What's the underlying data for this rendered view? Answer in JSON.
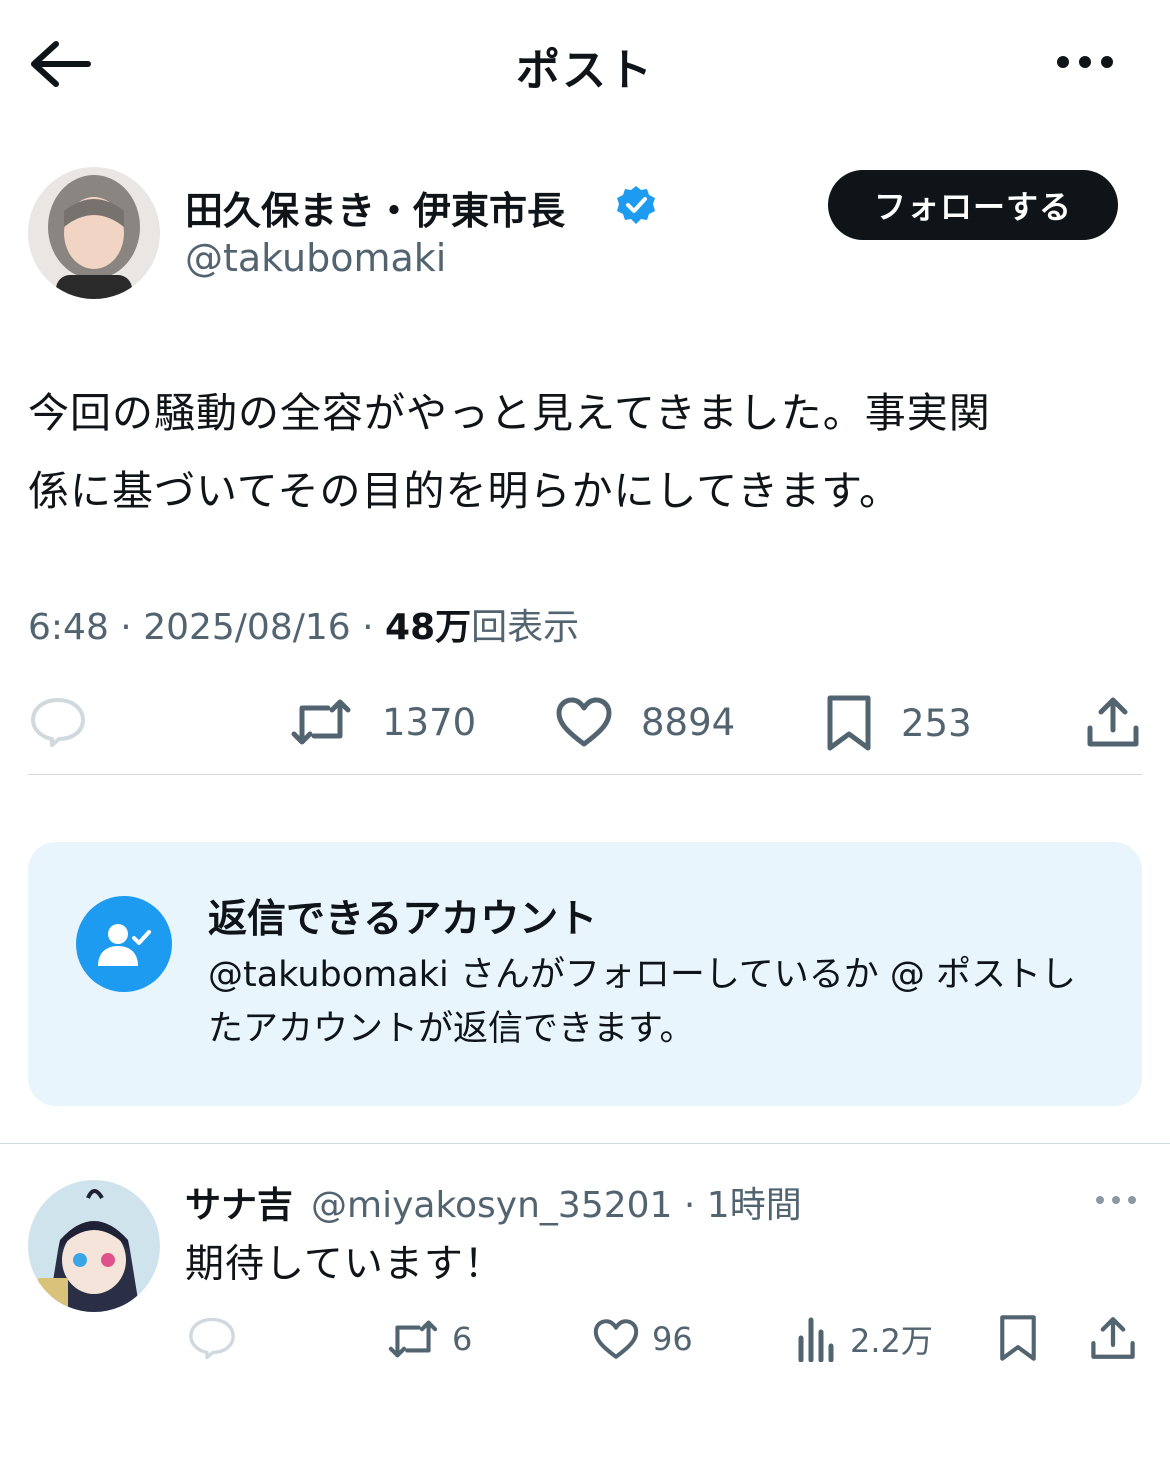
{
  "header": {
    "title": "ポスト"
  },
  "post": {
    "author_name": "田久保まき・伊東市長",
    "handle": "@takubomaki",
    "follow_label": "フォローする",
    "text_line1": "今回の騒動の全容がやっと見えてきました。事実関",
    "text_line2": "係に基づいてその目的を明らかにしてきます。",
    "time": "6:48",
    "date": "2025/08/16",
    "views_count": "48万",
    "views_label": "回表示",
    "retweets": "1370",
    "likes": "8894",
    "bookmarks": "253"
  },
  "restriction": {
    "title": "返信できるアカウント",
    "description": "@takubomaki さんがフォローしているか @ ポストしたアカウントが返信できます。"
  },
  "reply": {
    "name": "サナ吉",
    "handle": "@miyakosyn_35201",
    "time": "1時間",
    "text": "期待しています！",
    "retweets": "6",
    "likes": "96",
    "views": "2.2万"
  },
  "colors": {
    "text": "#0f1419",
    "muted": "#536471",
    "accent": "#1d9bf0",
    "panel": "#e8f5fd"
  }
}
